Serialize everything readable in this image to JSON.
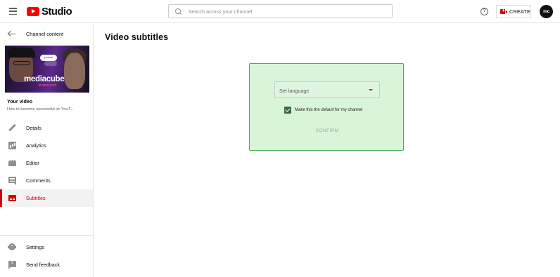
{
  "header": {
    "logo_text": "Studio",
    "search_placeholder": "Search across your channel",
    "help_glyph": "?",
    "create_label": "CREATE",
    "avatar_text": "mc"
  },
  "sidebar": {
    "back_label": "Channel content",
    "thumbnail": {
      "brand": "mediacube",
      "brand_sub": "PODCAST",
      "bubble": "podcast"
    },
    "your_video_label": "Your video",
    "video_title": "How to become successful on YouT...",
    "items": [
      {
        "label": "Details",
        "icon": "pencil-icon",
        "active": false
      },
      {
        "label": "Analytics",
        "icon": "analytics-icon",
        "active": false
      },
      {
        "label": "Editor",
        "icon": "editor-icon",
        "active": false
      },
      {
        "label": "Comments",
        "icon": "comments-icon",
        "active": false
      },
      {
        "label": "Subtitles",
        "icon": "subtitles-icon",
        "active": true
      }
    ],
    "bottom_items": [
      {
        "label": "Settings",
        "icon": "gear-icon"
      },
      {
        "label": "Send feedback",
        "icon": "feedback-icon"
      }
    ]
  },
  "main": {
    "title": "Video subtitles",
    "panel": {
      "language_select_value": "Set language",
      "default_checkbox_checked": true,
      "default_checkbox_label": "Make this the default for my channel",
      "confirm_label": "CONFIRM"
    }
  },
  "colors": {
    "brand_red": "#ff0000",
    "active_red": "#cc0000",
    "panel_bg": "#d9f5d9",
    "panel_border": "#4caf50"
  }
}
